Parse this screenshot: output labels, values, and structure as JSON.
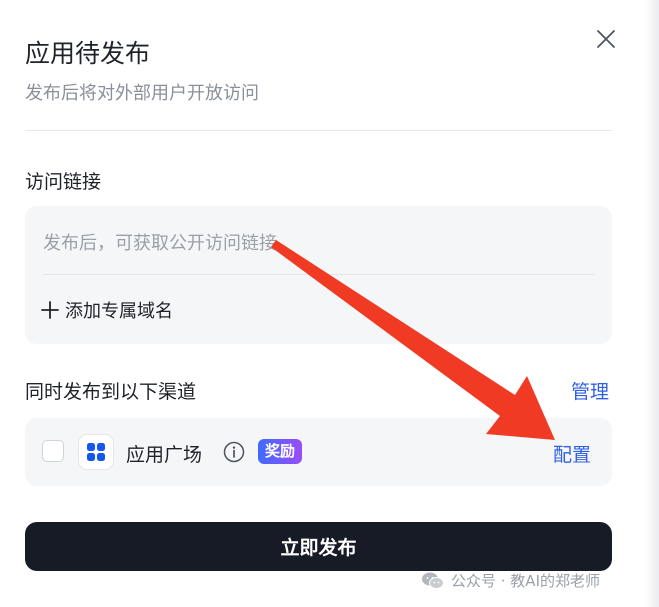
{
  "dialog": {
    "title": "应用待发布",
    "subtitle": "发布后将对外部用户开放访问"
  },
  "access_link": {
    "section_label": "访问链接",
    "placeholder": "发布后，可获取公开访问链接",
    "add_domain_label": "添加专属域名"
  },
  "channels": {
    "section_label": "同时发布到以下渠道",
    "manage_label": "管理",
    "items": [
      {
        "name": "应用广场",
        "badge": "奖励",
        "action_label": "配置",
        "checked": false,
        "icon": "app-grid-icon"
      }
    ]
  },
  "publish_button_label": "立即发布",
  "watermark": {
    "text": "公众号 · 教AI的郑老师",
    "icon": "wechat-icon"
  },
  "colors": {
    "accent_link": "#2f5fe6",
    "primary_button": "#161b25",
    "annotation_arrow": "#f03a24",
    "badge_gradient_start": "#3f6bff",
    "badge_gradient_end": "#9a4df8"
  }
}
